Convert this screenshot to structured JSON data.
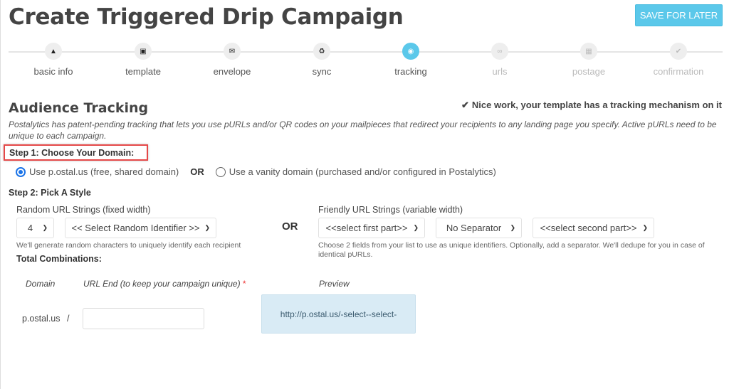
{
  "header": {
    "title": "Create Triggered Drip Campaign",
    "save_label": "SAVE FOR LATER"
  },
  "stepper": {
    "steps": [
      {
        "label": "basic info",
        "icon": "user-icon",
        "glyph": "▲",
        "state": "done"
      },
      {
        "label": "template",
        "icon": "image-icon",
        "glyph": "▣",
        "state": "done"
      },
      {
        "label": "envelope",
        "icon": "envelope-icon",
        "glyph": "✉",
        "state": "done"
      },
      {
        "label": "sync",
        "icon": "recycle-icon",
        "glyph": "♻",
        "state": "done"
      },
      {
        "label": "tracking",
        "icon": "target-icon",
        "glyph": "◉",
        "state": "active"
      },
      {
        "label": "urls",
        "icon": "link-icon",
        "glyph": "∞",
        "state": "future"
      },
      {
        "label": "postage",
        "icon": "calendar-icon",
        "glyph": "▦",
        "state": "future"
      },
      {
        "label": "confirmation",
        "icon": "check-icon",
        "glyph": "✔",
        "state": "future"
      }
    ]
  },
  "tracking": {
    "title": "Audience Tracking",
    "status_message": "Nice work, your template has a tracking mechanism on it",
    "description": "Postalytics has patent-pending tracking that lets you use pURLs and/or QR codes on your mailpieces that redirect your recipients to any landing page you specify. Active pURLs need to be unique to each campaign.",
    "step1": {
      "label": "Step 1: Choose Your Domain:",
      "option_shared": "Use p.ostal.us (free, shared domain)",
      "option_shared_checked": true,
      "or_label": "OR",
      "option_vanity": "Use a vanity domain (purchased and/or configured in Postalytics)",
      "option_vanity_checked": false
    },
    "step2": {
      "label": "Step 2: Pick A Style",
      "random": {
        "label": "Random URL Strings (fixed width)",
        "length_value": "4",
        "identifier_value": "<< Select Random Identifier >>",
        "help": "We'll generate random characters to uniquely identify each recipient"
      },
      "or_label": "OR",
      "friendly": {
        "label": "Friendly URL Strings (variable width)",
        "first_part_value": "<<select first part>>",
        "separator_value": "No Separator",
        "second_part_value": "<<select second part>>",
        "help": "Choose 2 fields from your list to use as unique identifiers. Optionally, add a separator. We'll dedupe for you in case of identical pURLs."
      },
      "total_combinations_label": "Total Combinations:"
    },
    "url_table": {
      "col_domain": "Domain",
      "col_url_end": "URL End (to keep your campaign unique)",
      "required_mark": "*",
      "col_preview": "Preview",
      "domain_value": "p.ostal.us",
      "separator": "/",
      "url_end_value": "",
      "preview_value": "http://p.ostal.us/-select--select-"
    }
  }
}
